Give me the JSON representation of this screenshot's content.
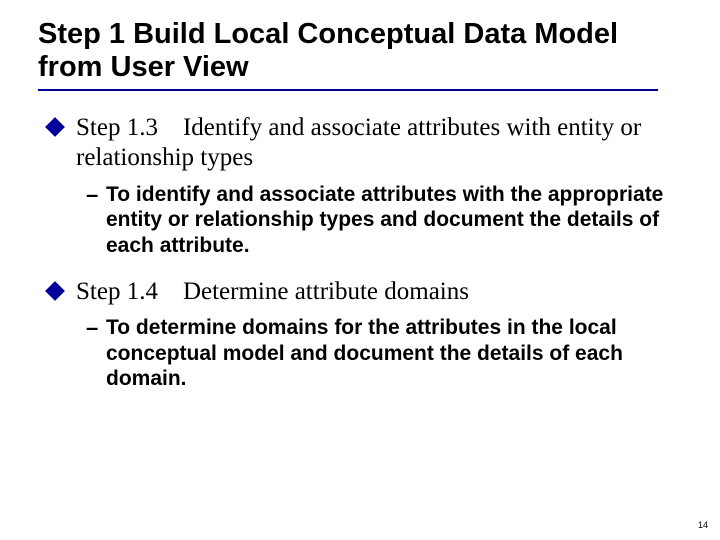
{
  "title": "Step 1 Build Local Conceptual Data Model from User View",
  "items": [
    {
      "heading_html": "Step 1.3 Identify and associate attributes with entity or relationship types",
      "sub": "To identify and associate attributes with the appropriate entity or relationship types and document the details of each attribute."
    },
    {
      "heading_html": "Step 1.4 Determine attribute domains",
      "sub": "To determine domains for the attributes in the local conceptual model and document the details of each domain."
    }
  ],
  "page_number": "14"
}
